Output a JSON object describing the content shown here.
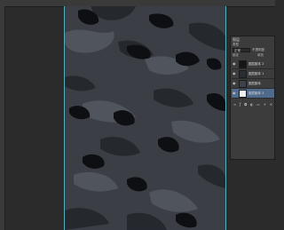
{
  "layers_panel": {
    "title": "图层",
    "kind_label": "类型",
    "blend_mode": "正常",
    "opacity_label": "不透明度",
    "lock_label": "锁定",
    "fill_label": "填充",
    "layers": [
      {
        "name": "图层副本 2",
        "selected": false,
        "thumb": "pattern"
      },
      {
        "name": "图层副本 1",
        "selected": false,
        "thumb": "pattern"
      },
      {
        "name": "图层副本",
        "selected": false,
        "thumb": "pattern"
      },
      {
        "name": "图层副本 3",
        "selected": true,
        "thumb": "white"
      }
    ],
    "footer_icons": [
      "link-icon",
      "fx-icon",
      "mask-icon",
      "adjustment-icon",
      "folder-icon",
      "new-layer-icon",
      "trash-icon"
    ]
  },
  "colors": {
    "canvas_base": "#3b3f45",
    "camo_dark": "#0e0f12",
    "camo_mid": "#23262b",
    "camo_light": "#565c66",
    "selected_layer": "#506a8c",
    "guide": "#5fd0e0"
  }
}
